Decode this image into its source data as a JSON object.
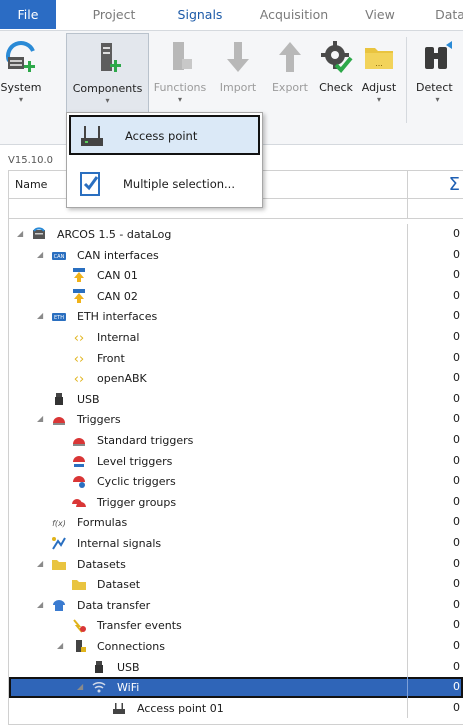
{
  "tabs": [
    "File",
    "Project",
    "Signals",
    "Acquisition",
    "View",
    "Data"
  ],
  "ribbon": {
    "system": "System",
    "components": "Components",
    "functions": "Functions",
    "import": "Import",
    "export": "Export",
    "check": "Check",
    "adjust": "Adjust",
    "detect": "Detect"
  },
  "version": "V15.10.0",
  "grid": {
    "name_header": "Name",
    "sum_header": "Σ",
    "rows": [
      {
        "label": "ARCOS 1.5 - dataLog",
        "count": "0"
      },
      {
        "label": "CAN interfaces",
        "count": "0"
      },
      {
        "label": "CAN 01",
        "count": "0"
      },
      {
        "label": "CAN 02",
        "count": "0"
      },
      {
        "label": "ETH interfaces",
        "count": "0"
      },
      {
        "label": "Internal",
        "count": "0"
      },
      {
        "label": "Front",
        "count": "0"
      },
      {
        "label": "openABK",
        "count": "0"
      },
      {
        "label": "USB",
        "count": "0"
      },
      {
        "label": "Triggers",
        "count": "0"
      },
      {
        "label": "Standard triggers",
        "count": "0"
      },
      {
        "label": "Level triggers",
        "count": "0"
      },
      {
        "label": "Cyclic triggers",
        "count": "0"
      },
      {
        "label": "Trigger groups",
        "count": "0"
      },
      {
        "label": "Formulas",
        "count": "0"
      },
      {
        "label": "Internal signals",
        "count": "0"
      },
      {
        "label": "Datasets",
        "count": "0"
      },
      {
        "label": "Dataset",
        "count": "0"
      },
      {
        "label": "Data transfer",
        "count": "0"
      },
      {
        "label": "Transfer events",
        "count": "0"
      },
      {
        "label": "Connections",
        "count": "0"
      },
      {
        "label": "USB",
        "count": "0"
      },
      {
        "label": "WiFi",
        "count": "0"
      },
      {
        "label": "Access point 01",
        "count": "0"
      }
    ]
  },
  "menu": {
    "access_point": "Access point",
    "multiple_selection": "Multiple selection..."
  },
  "colors": {
    "accent": "#2b6cc4",
    "selection": "#2f65b8",
    "tab_active": "#1c5aa8"
  }
}
